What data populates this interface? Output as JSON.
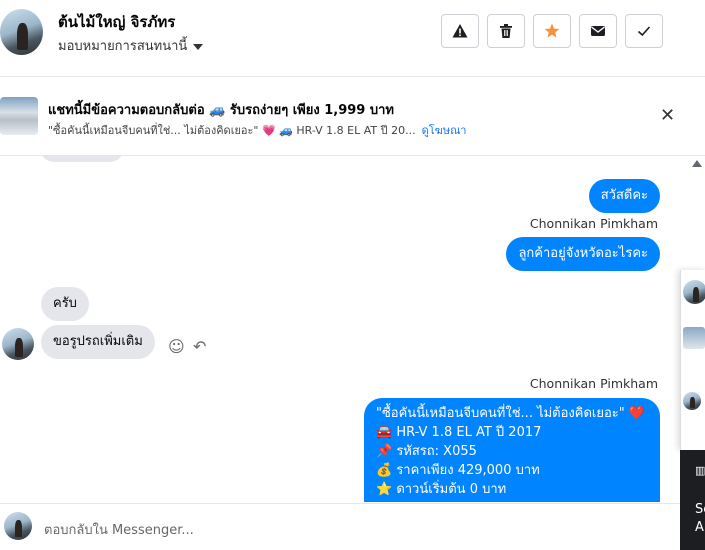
{
  "header": {
    "name": "ต้นไม้ใหญ่ จิรภัทร",
    "assign_label": "มอบหมายการสนทนานี้",
    "actions": [
      "warning-icon",
      "trash-icon",
      "star-icon",
      "mail-icon",
      "check-icon"
    ],
    "star_color": "#f7923b"
  },
  "banner": {
    "title": "แชทนี้มีข้อความตอบกลับต่อ 🚙 รับรถง่ายๆ เพียง 1,999 บาท",
    "subtitle": "\"ซื้อคันนี้เหมือนจีบคนที่ใช่... ไม่ต้องคิดเยอะ\" 💗 🚙 HR-V 1.8 EL AT ปี 20...",
    "link": "ดูโฆษณา"
  },
  "messages": {
    "out1": "สวัสดีคะ",
    "sender1": "Chonnikan Pimkham",
    "out2": "ลูกค้าอยู่จังหวัดอะไรคะ",
    "in1": "ครับ",
    "in2": "ขอรูปรถเพิ่มเติม",
    "sender2": "Chonnikan Pimkham",
    "ad_lines": [
      "\"ซื้อคันนี้เหมือนจีบคนที่ใช่... ไม่ต้องคิดเยอะ\" ❤️",
      "🚘 HR-V 1.8 EL AT ปี 2017",
      "📌 รหัสรถ: X055",
      "💰 ราคาเพียง 429,000 บาท",
      "⭐ ดาวน์เริ่มต้น 0 บาท"
    ]
  },
  "side_panel": {
    "dark_text_1": "Se",
    "dark_text_2": "A"
  },
  "footer": {
    "reply_placeholder": "ตอบกลับใน Messenger..."
  },
  "colors": {
    "accent": "#0084ff",
    "incoming": "#e4e6eb",
    "link": "#1877f2"
  }
}
